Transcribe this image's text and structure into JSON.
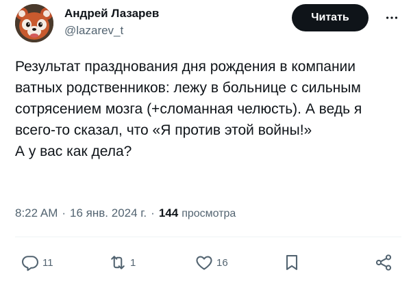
{
  "author": {
    "display_name": "Андрей Лазарев",
    "handle": "@lazarev_t"
  },
  "follow_button_label": "Читать",
  "more_icon": "more-horizontal-icon",
  "tweet": {
    "text": "Результат празднования дня рождения в компании ватных родственников: лежу в больнице с сильным сотрясением мозга (+сломанная челюсть). А ведь я всего-то сказал, что «Я против этой войны!»\nА у вас как дела?",
    "time": "8:22 AM",
    "separator": "·",
    "date": "16 янв. 2024 г.",
    "views_count": "144",
    "views_label": "просмотра"
  },
  "actions": {
    "reply_count": "11",
    "retweet_count": "1",
    "like_count": "16"
  },
  "colors": {
    "text": "#0f1419",
    "secondary": "#536471",
    "button_bg": "#0f1419",
    "button_text": "#ffffff"
  }
}
